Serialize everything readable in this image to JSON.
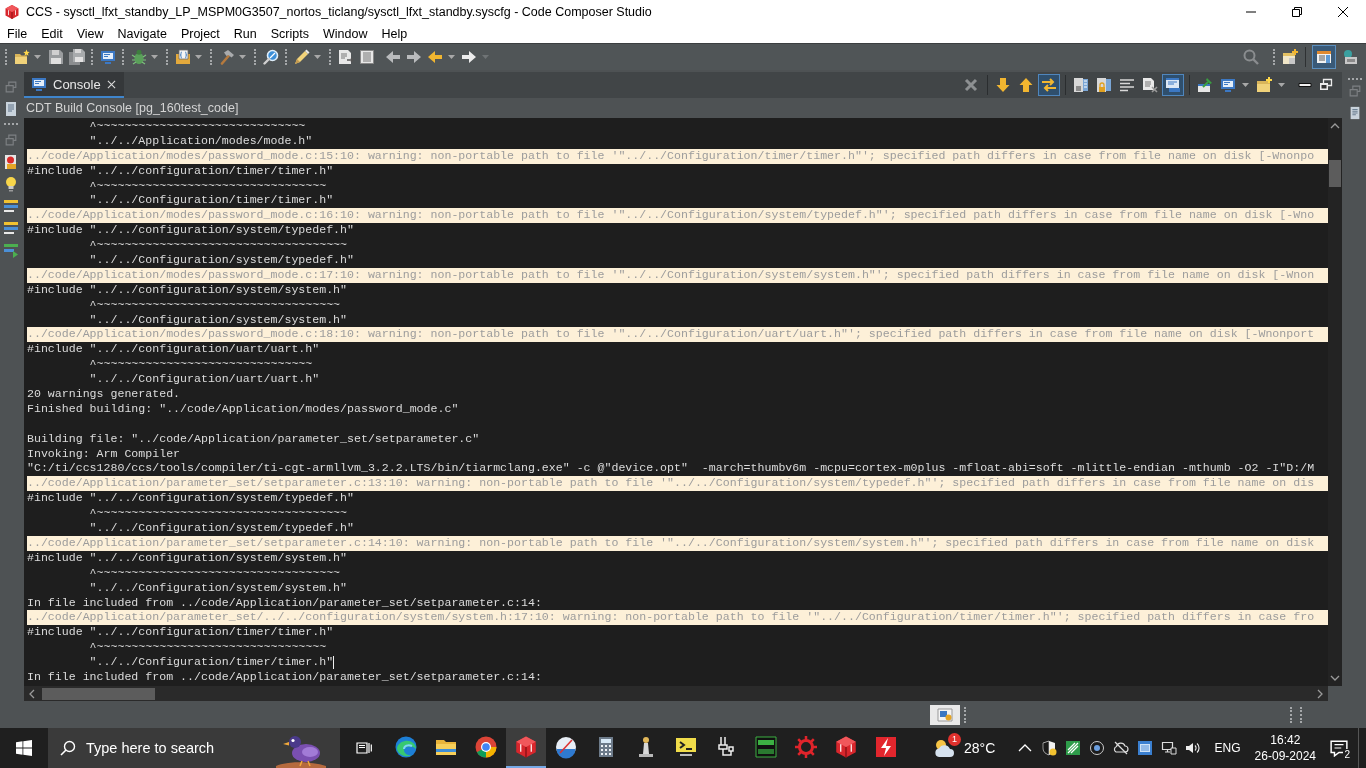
{
  "window": {
    "title": "CCS - sysctl_lfxt_standby_LP_MSPM0G3507_nortos_ticlang/sysctl_lfxt_standby.syscfg - Code Composer Studio"
  },
  "menu": [
    "File",
    "Edit",
    "View",
    "Navigate",
    "Project",
    "Run",
    "Scripts",
    "Window",
    "Help"
  ],
  "perspectives": [
    {
      "kind": "edit",
      "selected": true
    },
    {
      "kind": "debug",
      "selected": false
    }
  ],
  "console": {
    "tabs": [
      {
        "label": "Console",
        "selected": true
      }
    ],
    "toolbar": [
      [
        {
          "kind": "clear",
          "on": false
        }
      ],
      [
        {
          "kind": "down",
          "on": false
        },
        {
          "kind": "up",
          "on": false
        },
        {
          "kind": "swap",
          "on": true
        }
      ],
      [
        {
          "kind": "saveout",
          "on": false
        },
        {
          "kind": "lock",
          "on": false
        },
        {
          "kind": "wrap",
          "on": false
        },
        {
          "kind": "remove",
          "on": false
        },
        {
          "kind": "show",
          "on": true
        }
      ],
      [
        {
          "kind": "pin",
          "on": false
        },
        {
          "kind": "display",
          "on": false
        },
        {
          "kind": "newconsole",
          "on": false
        }
      ]
    ],
    "title": "CDT Build Console [pg_160test_code]",
    "lines": [
      {
        "kind": "plain",
        "text": "         ^~~~~~~~~~~~~~~~~~~~~~~~~~~~~~~"
      },
      {
        "kind": "plain",
        "text": "         \"../../Application/modes/mode.h\""
      },
      {
        "kind": "warning",
        "text": "../code/Application/modes/password_mode.c:15:10: warning: non-portable path to file '\"../../Configuration/timer/timer.h\"'; specified path differs in case from file name on disk [-Wnonpo"
      },
      {
        "kind": "plain",
        "text": "#include \"../../configuration/timer/timer.h\""
      },
      {
        "kind": "plain",
        "text": "         ^~~~~~~~~~~~~~~~~~~~~~~~~~~~~~~~~~"
      },
      {
        "kind": "plain",
        "text": "         \"../../Configuration/timer/timer.h\""
      },
      {
        "kind": "warning",
        "text": "../code/Application/modes/password_mode.c:16:10: warning: non-portable path to file '\"../../Configuration/system/typedef.h\"'; specified path differs in case from file name on disk [-Wno"
      },
      {
        "kind": "plain",
        "text": "#include \"../../configuration/system/typedef.h\""
      },
      {
        "kind": "plain",
        "text": "         ^~~~~~~~~~~~~~~~~~~~~~~~~~~~~~~~~~~~~"
      },
      {
        "kind": "plain",
        "text": "         \"../../Configuration/system/typedef.h\""
      },
      {
        "kind": "warning",
        "text": "../code/Application/modes/password_mode.c:17:10: warning: non-portable path to file '\"../../Configuration/system/system.h\"'; specified path differs in case from file name on disk [-Wnon"
      },
      {
        "kind": "plain",
        "text": "#include \"../../configuration/system/system.h\""
      },
      {
        "kind": "plain",
        "text": "         ^~~~~~~~~~~~~~~~~~~~~~~~~~~~~~~~~~~~"
      },
      {
        "kind": "plain",
        "text": "         \"../../Configuration/system/system.h\""
      },
      {
        "kind": "warning",
        "text": "../code/Application/modes/password_mode.c:18:10: warning: non-portable path to file '\"../../Configuration/uart/uart.h\"'; specified path differs in case from file name on disk [-Wnonport"
      },
      {
        "kind": "plain",
        "text": "#include \"../../configuration/uart/uart.h\""
      },
      {
        "kind": "plain",
        "text": "         ^~~~~~~~~~~~~~~~~~~~~~~~~~~~~~~~"
      },
      {
        "kind": "plain",
        "text": "         \"../../Configuration/uart/uart.h\""
      },
      {
        "kind": "plain",
        "text": "20 warnings generated."
      },
      {
        "kind": "plain",
        "text": "Finished building: \"../code/Application/modes/password_mode.c\""
      },
      {
        "kind": "blank"
      },
      {
        "kind": "plain",
        "text": "Building file: \"../code/Application/parameter_set/setparameter.c\""
      },
      {
        "kind": "plain",
        "text": "Invoking: Arm Compiler"
      },
      {
        "kind": "plain",
        "text": "\"C:/ti/ccs1280/ccs/tools/compiler/ti-cgt-armllvm_3.2.2.LTS/bin/tiarmclang.exe\" -c @\"device.opt\"  -march=thumbv6m -mcpu=cortex-m0plus -mfloat-abi=soft -mlittle-endian -mthumb -O2 -I\"D:/M"
      },
      {
        "kind": "warning",
        "text": "../code/Application/parameter_set/setparameter.c:13:10: warning: non-portable path to file '\"../../Configuration/system/typedef.h\"'; specified path differs in case from file name on dis"
      },
      {
        "kind": "plain",
        "text": "#include \"../../configuration/system/typedef.h\""
      },
      {
        "kind": "plain",
        "text": "         ^~~~~~~~~~~~~~~~~~~~~~~~~~~~~~~~~~~~~"
      },
      {
        "kind": "plain",
        "text": "         \"../../Configuration/system/typedef.h\""
      },
      {
        "kind": "warning",
        "text": "../code/Application/parameter_set/setparameter.c:14:10: warning: non-portable path to file '\"../../Configuration/system/system.h\"'; specified path differs in case from file name on disk"
      },
      {
        "kind": "plain",
        "text": "#include \"../../configuration/system/system.h\""
      },
      {
        "kind": "plain",
        "text": "         ^~~~~~~~~~~~~~~~~~~~~~~~~~~~~~~~~~~~"
      },
      {
        "kind": "plain",
        "text": "         \"../../Configuration/system/system.h\""
      },
      {
        "kind": "plain",
        "text": "In file included from ../code/Application/parameter_set/setparameter.c:14:"
      },
      {
        "kind": "warning",
        "text": "../code/Application/parameter_set/../../configuration/system/system.h:17:10: warning: non-portable path to file '\"../../Configuration/timer/timer.h\"'; specified path differs in case fro"
      },
      {
        "kind": "plain",
        "text": "#include \"../../configuration/timer/timer.h\""
      },
      {
        "kind": "plain",
        "text": "         ^~~~~~~~~~~~~~~~~~~~~~~~~~~~~~~~~~"
      },
      {
        "kind": "cursor",
        "text": "         \"../../Configuration/timer/timer.h\""
      },
      {
        "kind": "plain",
        "text": "In file included from ../code/Application/parameter_set/setparameter.c:14:"
      }
    ]
  },
  "taskbar": {
    "search": {
      "placeholder": "Type here to search"
    },
    "apps": [
      {
        "kind": "edge",
        "active": false
      },
      {
        "kind": "explorer",
        "active": false
      },
      {
        "kind": "chrome",
        "active": false
      },
      {
        "kind": "ccs",
        "active": true
      },
      {
        "kind": "sphere",
        "active": false
      },
      {
        "kind": "calculator",
        "active": false
      },
      {
        "kind": "term",
        "active": false
      },
      {
        "kind": "tterm",
        "active": false
      },
      {
        "kind": "usb",
        "active": false
      },
      {
        "kind": "fet",
        "active": false
      },
      {
        "kind": "gear",
        "active": false
      },
      {
        "kind": "cube",
        "active": false
      },
      {
        "kind": "flash",
        "active": false
      }
    ],
    "weather": {
      "badge": "1",
      "temperature": "28°C"
    },
    "language": "ENG",
    "time": "16:42",
    "date": "26-09-2024",
    "notifications": "2"
  }
}
